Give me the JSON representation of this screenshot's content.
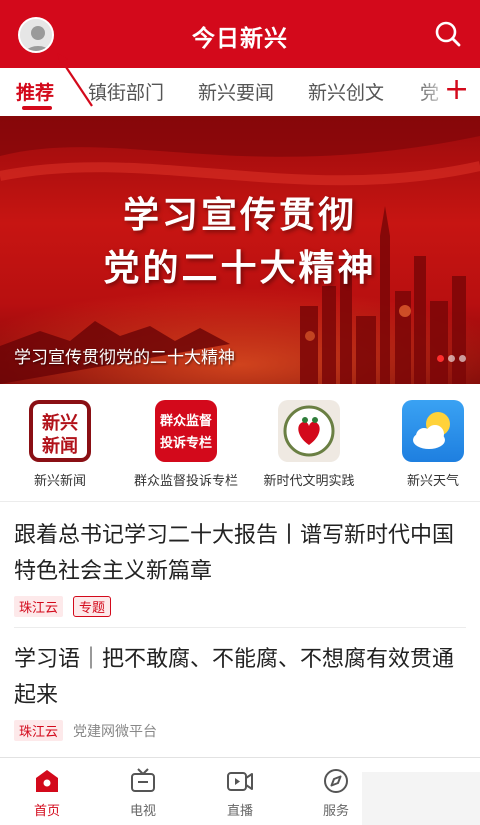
{
  "header": {
    "title": "今日新兴",
    "brand_color": "#d3091b"
  },
  "tabs": [
    {
      "label": "推荐",
      "active": true
    },
    {
      "label": "镇街部门",
      "active": false
    },
    {
      "label": "新兴要闻",
      "active": false
    },
    {
      "label": "新兴创文",
      "active": false
    },
    {
      "label": "党",
      "active": false
    }
  ],
  "add_tab_symbol": "+",
  "banner": {
    "title_line1": "学习宣传贯彻",
    "title_line2": "党的二十大精神",
    "caption": "学习宣传贯彻党的二十大精神",
    "slide_count": 3,
    "active_slide": 1
  },
  "quick_links": [
    {
      "label": "新兴新闻",
      "icon_text_1": "新兴",
      "icon_text_2": "新闻",
      "icon": "news-icon"
    },
    {
      "label": "群众监督投诉专栏",
      "icon_text_1": "群众监督",
      "icon_text_2": "投诉专栏",
      "icon": "complaint-icon"
    },
    {
      "label": "新时代文明实践",
      "icon": "civilization-practice-icon"
    },
    {
      "label": "新兴天气",
      "icon": "weather-icon"
    }
  ],
  "news": [
    {
      "title": "跟着总书记学习二十大报告丨谱写新时代中国特色社会主义新篇章",
      "source_tag": "珠江云",
      "topic_tag": "专题"
    },
    {
      "title": "学习语｜把不敢腐、不能腐、不想腐有效贯通起来",
      "source_tag": "珠江云",
      "publisher": "党建网微平台"
    }
  ],
  "bottom_nav": [
    {
      "label": "首页",
      "icon": "home-icon",
      "active": true
    },
    {
      "label": "电视",
      "icon": "tv-icon",
      "active": false
    },
    {
      "label": "直播",
      "icon": "live-icon",
      "active": false
    },
    {
      "label": "服务",
      "icon": "compass-icon",
      "active": false
    }
  ]
}
